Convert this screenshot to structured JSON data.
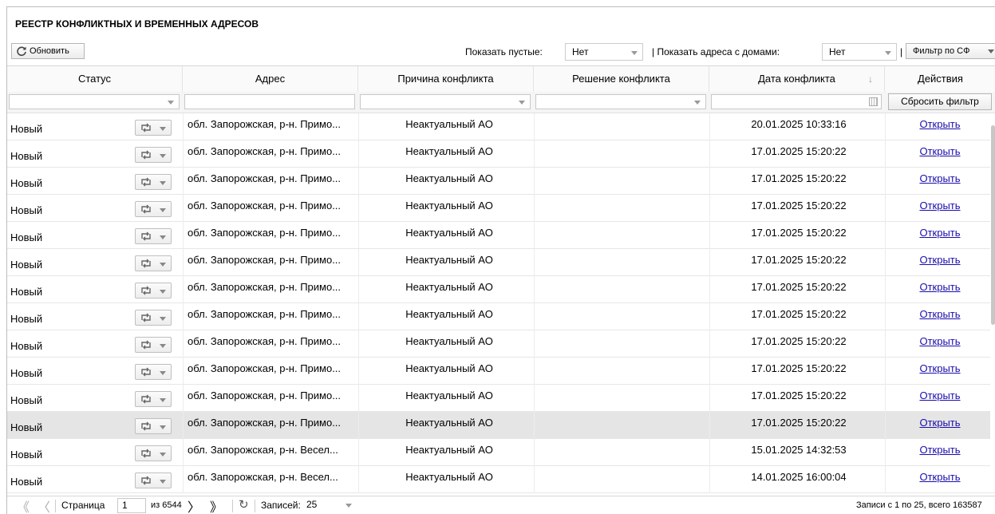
{
  "title": "РЕЕСТР КОНФЛИКТНЫХ И ВРЕМЕННЫХ АДРЕСОВ",
  "toolbar": {
    "refresh_label": "Обновить",
    "show_empty_label": "Показать пустые:",
    "show_empty_value": "Нет",
    "show_with_houses_label": "| Показать адреса с домами:",
    "show_with_houses_value": "Нет",
    "sep": "|",
    "filter_sf_label": "Фильтр по СФ"
  },
  "columns": {
    "status": "Статус",
    "address": "Адрес",
    "reason": "Причина конфликта",
    "solution": "Решение конфликта",
    "date": "Дата конфликта",
    "date_sort": "↓",
    "actions": "Действия"
  },
  "reset_filter_label": "Сбросить фильтр",
  "rows": [
    {
      "status": "Новый",
      "address": "обл. Запорожская, р-н. Примо...",
      "reason": "Неактуальный АО",
      "solution": "",
      "date": "20.01.2025 10:33:16",
      "action": "Открыть"
    },
    {
      "status": "Новый",
      "address": "обл. Запорожская, р-н. Примо...",
      "reason": "Неактуальный АО",
      "solution": "",
      "date": "17.01.2025 15:20:22",
      "action": "Открыть"
    },
    {
      "status": "Новый",
      "address": "обл. Запорожская, р-н. Примо...",
      "reason": "Неактуальный АО",
      "solution": "",
      "date": "17.01.2025 15:20:22",
      "action": "Открыть"
    },
    {
      "status": "Новый",
      "address": "обл. Запорожская, р-н. Примо...",
      "reason": "Неактуальный АО",
      "solution": "",
      "date": "17.01.2025 15:20:22",
      "action": "Открыть"
    },
    {
      "status": "Новый",
      "address": "обл. Запорожская, р-н. Примо...",
      "reason": "Неактуальный АО",
      "solution": "",
      "date": "17.01.2025 15:20:22",
      "action": "Открыть"
    },
    {
      "status": "Новый",
      "address": "обл. Запорожская, р-н. Примо...",
      "reason": "Неактуальный АО",
      "solution": "",
      "date": "17.01.2025 15:20:22",
      "action": "Открыть"
    },
    {
      "status": "Новый",
      "address": "обл. Запорожская, р-н. Примо...",
      "reason": "Неактуальный АО",
      "solution": "",
      "date": "17.01.2025 15:20:22",
      "action": "Открыть"
    },
    {
      "status": "Новый",
      "address": "обл. Запорожская, р-н. Примо...",
      "reason": "Неактуальный АО",
      "solution": "",
      "date": "17.01.2025 15:20:22",
      "action": "Открыть"
    },
    {
      "status": "Новый",
      "address": "обл. Запорожская, р-н. Примо...",
      "reason": "Неактуальный АО",
      "solution": "",
      "date": "17.01.2025 15:20:22",
      "action": "Открыть"
    },
    {
      "status": "Новый",
      "address": "обл. Запорожская, р-н. Примо...",
      "reason": "Неактуальный АО",
      "solution": "",
      "date": "17.01.2025 15:20:22",
      "action": "Открыть"
    },
    {
      "status": "Новый",
      "address": "обл. Запорожская, р-н. Примо...",
      "reason": "Неактуальный АО",
      "solution": "",
      "date": "17.01.2025 15:20:22",
      "action": "Открыть"
    },
    {
      "status": "Новый",
      "address": "обл. Запорожская, р-н. Примо...",
      "reason": "Неактуальный АО",
      "solution": "",
      "date": "17.01.2025 15:20:22",
      "action": "Открыть",
      "selected": true
    },
    {
      "status": "Новый",
      "address": "обл. Запорожская, р-н. Весел...",
      "reason": "Неактуальный АО",
      "solution": "",
      "date": "15.01.2025 14:32:53",
      "action": "Открыть"
    },
    {
      "status": "Новый",
      "address": "обл. Запорожская, р-н. Весел...",
      "reason": "Неактуальный АО",
      "solution": "",
      "date": "14.01.2025 16:00:04",
      "action": "Открыть"
    }
  ],
  "pager": {
    "page_label": "Страница",
    "page_value": "1",
    "of_pages": "из 6544",
    "records_label": "Записей:",
    "records_value": "25",
    "summary": "Записи с 1 по 25, всего 163587"
  }
}
